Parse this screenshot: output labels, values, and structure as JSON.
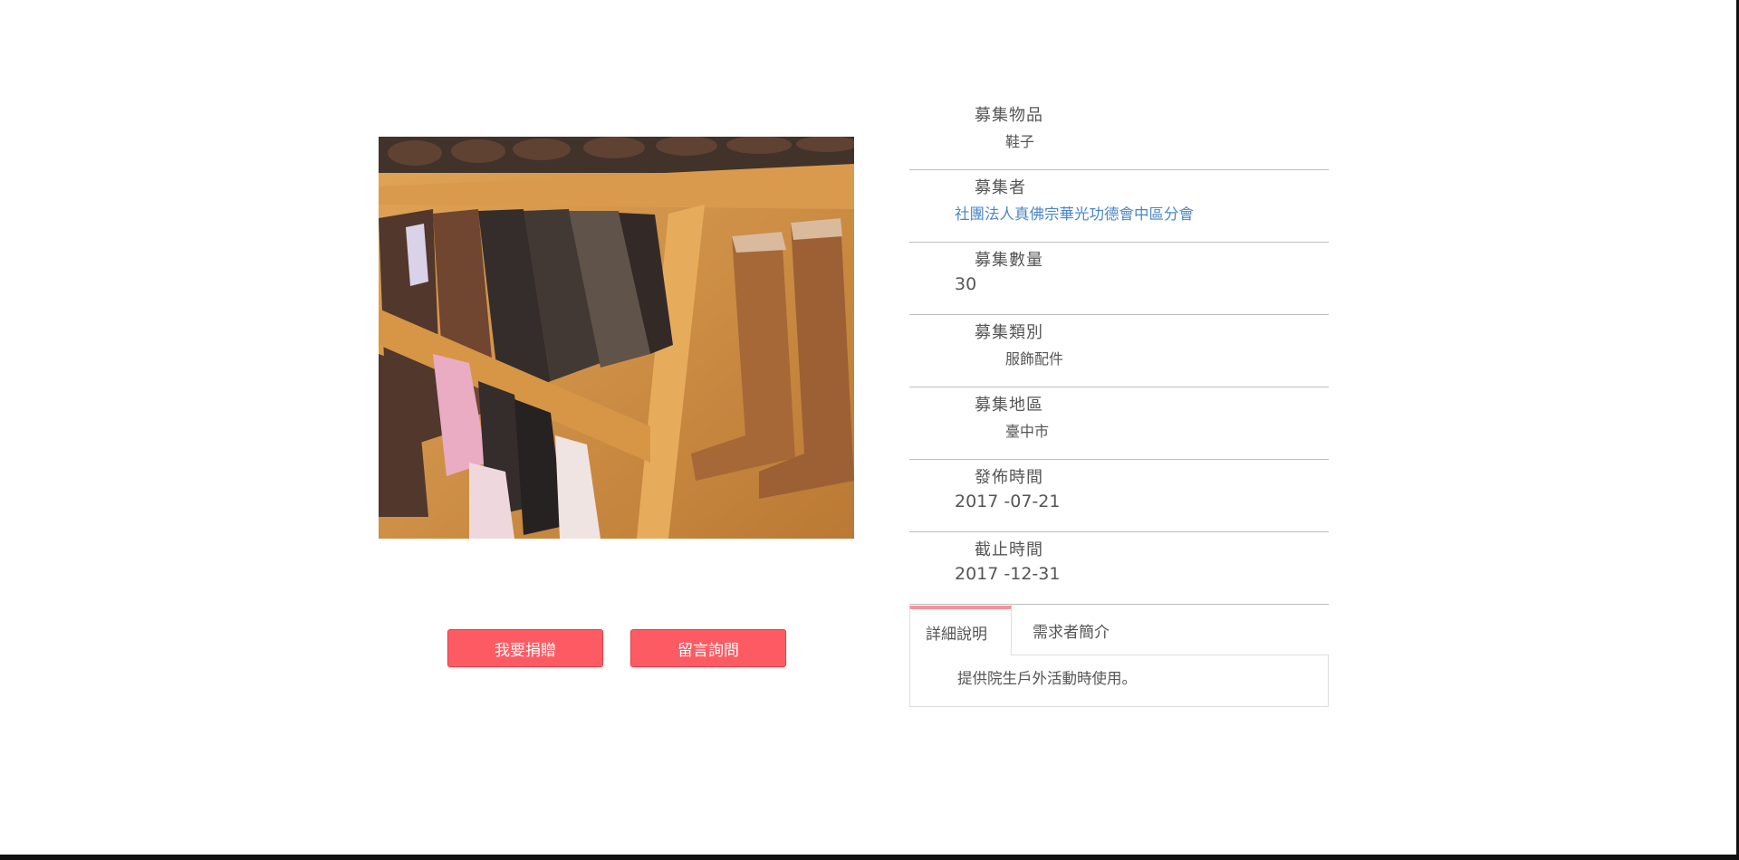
{
  "actions": {
    "donate_label": "我要捐贈",
    "inquire_label": "留言詢問"
  },
  "details": {
    "item": {
      "label": "募集物品",
      "value": "鞋子"
    },
    "collector": {
      "label": "募集者",
      "value": "社團法人真佛宗華光功德會中區分會"
    },
    "quantity": {
      "label": "募集數量",
      "value": "30"
    },
    "category": {
      "label": "募集類別",
      "value": "服飾配件"
    },
    "region": {
      "label": "募集地區",
      "value": "臺中市"
    },
    "published": {
      "label": "發佈時間",
      "value": "2017 -07-21"
    },
    "deadline": {
      "label": "截止時間",
      "value": "2017 -12-31"
    }
  },
  "tabs": {
    "detail_label": "詳細說明",
    "requester_label": "需求者簡介",
    "detail_text": "提供院生戶外活動時使用。"
  },
  "colors": {
    "button": "#fd5b63",
    "link": "#4a86c5",
    "tab_accent": "#f7919a"
  }
}
